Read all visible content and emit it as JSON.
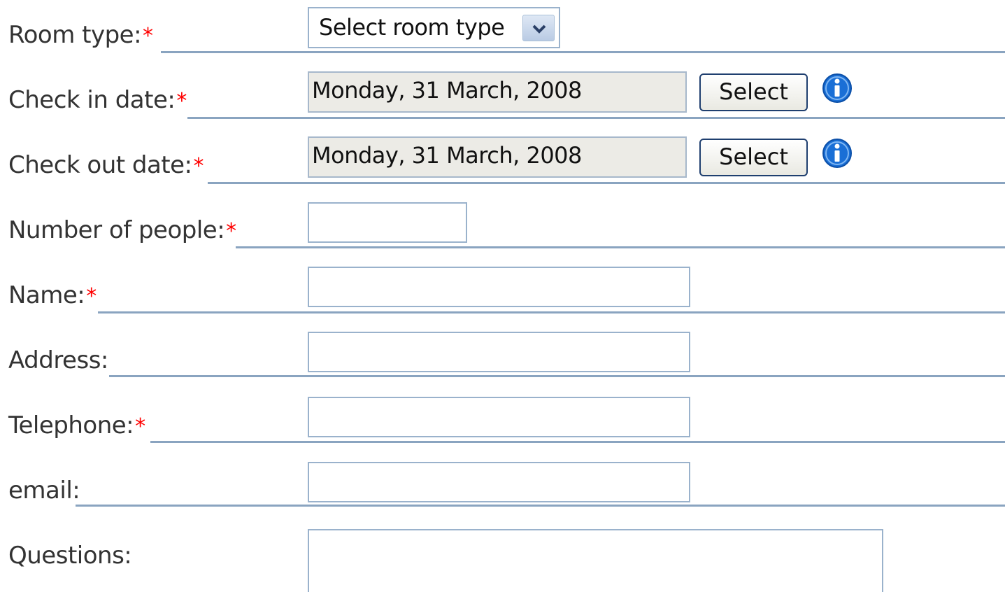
{
  "form": {
    "room_type": {
      "label": "Room type:",
      "required": "*",
      "selected": "Select room type"
    },
    "check_in": {
      "label": "Check in date:",
      "required": "*",
      "value": "Monday, 31 March, 2008",
      "button": "Select"
    },
    "check_out": {
      "label": "Check out date:",
      "required": "*",
      "value": "Monday, 31 March, 2008",
      "button": "Select"
    },
    "people": {
      "label": "Number of people:",
      "required": "*",
      "value": ""
    },
    "name": {
      "label": "Name:",
      "required": "*",
      "value": ""
    },
    "address": {
      "label": "Address:",
      "value": ""
    },
    "telephone": {
      "label": "Telephone:",
      "required": "*",
      "value": ""
    },
    "email": {
      "label": "email:",
      "value": ""
    },
    "questions": {
      "label": "Questions:",
      "value": ""
    }
  },
  "icons": {
    "dropdown": "chevron-down-icon",
    "info": "info-icon"
  },
  "colors": {
    "required_marker": "#ff0000",
    "field_border": "#9ab2cc",
    "rule_line": "#8aa4c0",
    "date_field_bg": "#ecebe6",
    "info_icon": "#1a6fd6"
  }
}
